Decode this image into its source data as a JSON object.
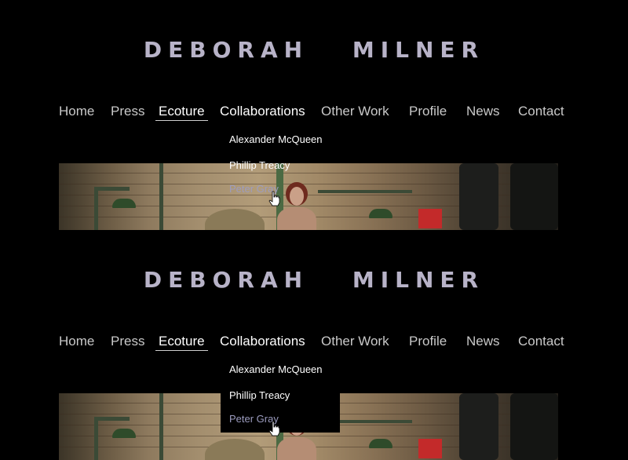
{
  "site": {
    "title": "DEBORAH MILNER"
  },
  "nav": {
    "items": [
      {
        "label": "Home"
      },
      {
        "label": "Press"
      },
      {
        "label": "Ecoture"
      },
      {
        "label": "Collaborations"
      },
      {
        "label": "Other Work"
      },
      {
        "label": "Profile"
      },
      {
        "label": "News"
      },
      {
        "label": "Contact"
      }
    ],
    "active": "Ecoture",
    "hovered": "Collaborations"
  },
  "dropdown": {
    "items": [
      {
        "label": "Alexander McQueen"
      },
      {
        "label": "Phillip Treacy"
      },
      {
        "label": "Peter Gray"
      }
    ],
    "hovered": "Peter Gray"
  },
  "hero": {
    "description_icon": "hero-banner-image"
  },
  "colors": {
    "background": "#000000",
    "title": "#b8b3c8",
    "nav_text": "#c9c9c9",
    "dropdown_hover": "#9c9cbf"
  }
}
